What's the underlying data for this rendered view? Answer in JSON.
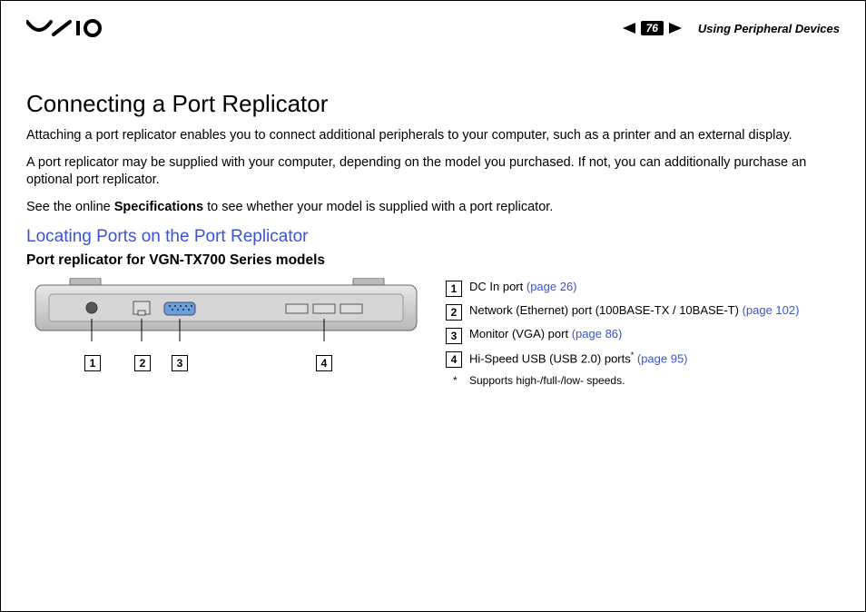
{
  "header": {
    "section": "Using Peripheral Devices",
    "page_number": "76"
  },
  "title": "Connecting a Port Replicator",
  "para1": "Attaching a port replicator enables you to connect additional peripherals to your computer, such as a printer and an external display.",
  "para2": "A port replicator may be supplied with your computer, depending on the model you purchased. If not, you can additionally purchase an optional port replicator.",
  "para3_pre": "See the online ",
  "para3_bold": "Specifications",
  "para3_post": " to see whether your model is supplied with a port replicator.",
  "subhead": "Locating Ports on the Port Replicator",
  "model_head": "Port replicator for VGN-TX700 Series models",
  "callouts": {
    "n1": "1",
    "n2": "2",
    "n3": "3",
    "n4": "4"
  },
  "legend": {
    "r1": {
      "num": "1",
      "text": "DC In port ",
      "link": "(page 26)"
    },
    "r2": {
      "num": "2",
      "text": "Network (Ethernet) port (100BASE-TX / 10BASE-T) ",
      "link": "(page 102)"
    },
    "r3": {
      "num": "3",
      "text": "Monitor (VGA) port ",
      "link": "(page 86)"
    },
    "r4": {
      "num": "4",
      "text": "Hi-Speed USB (USB 2.0) ports",
      "sup": "*",
      "link": " (page 95)"
    },
    "footnote": "Supports high-/full-/low- speeds."
  }
}
